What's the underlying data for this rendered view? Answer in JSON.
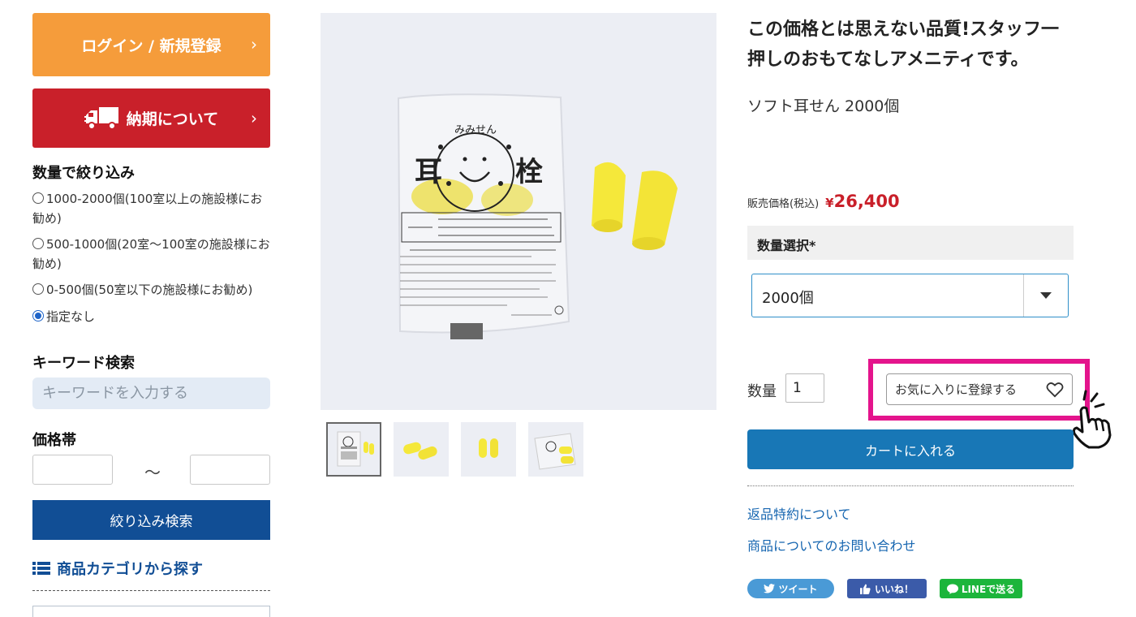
{
  "sidebar": {
    "login_label": "ログイン / 新規登録",
    "delivery_label": "納期について",
    "chevron": "›",
    "quantity_filter": {
      "title": "数量で絞り込み",
      "options": [
        {
          "label": "1000-2000個(100室以上の施設様にお勧め)",
          "checked": false
        },
        {
          "label": "500-1000個(20室〜100室の施設様にお勧め)",
          "checked": false
        },
        {
          "label": "0-500個(50室以下の施設様にお勧め)",
          "checked": false
        },
        {
          "label": "指定なし",
          "checked": true
        }
      ]
    },
    "keyword": {
      "title": "キーワード検索",
      "placeholder": "キーワードを入力する"
    },
    "price": {
      "title": "価格帯",
      "tilde": "〜"
    },
    "filter_button": "絞り込み検索",
    "category_link": "商品カテゴリから探す"
  },
  "product": {
    "headline": "この価格とは思えない品質!スタッフ一押しのおもてなしアメニティです。",
    "name": "ソフト耳せん 2000個",
    "price_label": "販売価格(税込)",
    "price_currency": "¥",
    "price_value": "26,400",
    "option_label": "数量選択*",
    "option_selected": "2000個",
    "qty_label": "数量",
    "qty_value": "1",
    "favorite_label": "お気に入りに登録する",
    "cart_label": "カートに入れる",
    "links": [
      "返品特約について",
      "商品についてのお問い合わせ"
    ],
    "share": {
      "tweet": "ツイート",
      "like": "いいね！",
      "line": "LINEで送る"
    }
  },
  "package": {
    "brand": "みみせん",
    "title_left": "耳",
    "title_right": "栓"
  },
  "colors": {
    "login": "#f59c3b",
    "delivery": "#c9202a",
    "filter": "#114e95",
    "cart": "#1877b6",
    "price": "#c9202a",
    "highlight": "#e4148c",
    "earplug": "#f5e83a"
  },
  "icons": [
    "truck-icon",
    "list-icon",
    "heart-icon",
    "hand-pointer-icon",
    "chevron-right-icon",
    "twitter-icon",
    "like-icon",
    "line-icon"
  ]
}
